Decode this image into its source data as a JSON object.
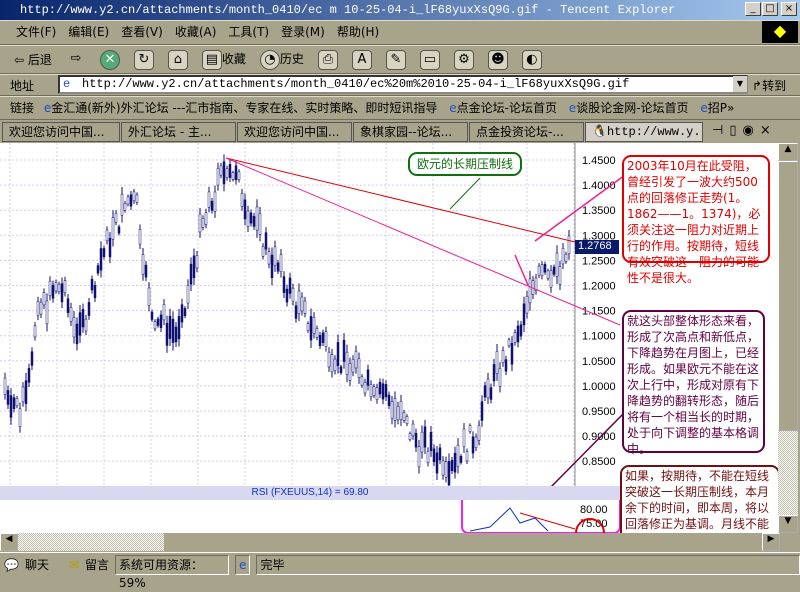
{
  "window": {
    "title": "http://www.y2.cn/attachments/month_0410/ec m 10-25-04-i_lF68yuxXsQ9G.gif - Tencent Explorer",
    "min": "_",
    "max": "□",
    "close": "×"
  },
  "menu": [
    "文件(F)",
    "编辑(E)",
    "查看(V)",
    "收藏(A)",
    "工具(T)",
    "登录(M)",
    "帮助(H)"
  ],
  "toolbar": {
    "back": "后退",
    "favorites": "收藏",
    "history": "历史"
  },
  "address": {
    "label": "地址",
    "value": "http://www.y2.cn/attachments/month_0410/ec%20m%2010-25-04-i_lF68yuxXsQ9G.gif",
    "go": "转到"
  },
  "links": {
    "label": "链接",
    "items": [
      "金汇通(新外)外汇论坛 ---汇市指南、专家在线、实时策略、即时短讯指导",
      "点金论坛-论坛首页",
      "谈股论金网-论坛首页",
      "招P»"
    ]
  },
  "tabs": [
    "欢迎您访问中国...",
    "外汇论坛 - 主...",
    "欢迎您访问中国...",
    "象棋家园--论坛...",
    "点金投资论坛-...",
    "http://www.y..."
  ],
  "chart": {
    "price_ticks": [
      "1.4500",
      "1.4000",
      "1.3500",
      "1.3000",
      "1.2500",
      "1.2000",
      "1.1500",
      "1.1000",
      "1.0500",
      "1.0000",
      "0.9500",
      "0.9000",
      "0.8500"
    ],
    "current": "1.2768",
    "rsi_label": "RSI (FXEUUS,14) = 69.80",
    "rsi_ticks": [
      "80.00",
      "75.00"
    ],
    "callout": "欧元的长期压制线",
    "note1": "2003年10月在此受阻，曾经引发了一波大约500点的回落修正走势(1。1862——1。1374)，必须关注这一阻力对近期上行的作用。按期待，短线有效突破这一阻力的可能性不是很大。",
    "note2": "就这头部整体形态来看，形成了次高点和新低点，下降趋势在月图上，已经形成。如果欧元不能在这次上行中，形成对原有下降趋势的翻转形态，随后将有一个相当长的时期，处于向下调整的基本格调中。",
    "note3": "如果，按期待，不能在短线突破这一长期压制线，本月余下的时间，即本周，将以回落修正为基调。月线不能"
  },
  "status": {
    "chat": "聊天",
    "message": "留言",
    "resources": "系统可用资源：59%",
    "done": "完毕"
  }
}
